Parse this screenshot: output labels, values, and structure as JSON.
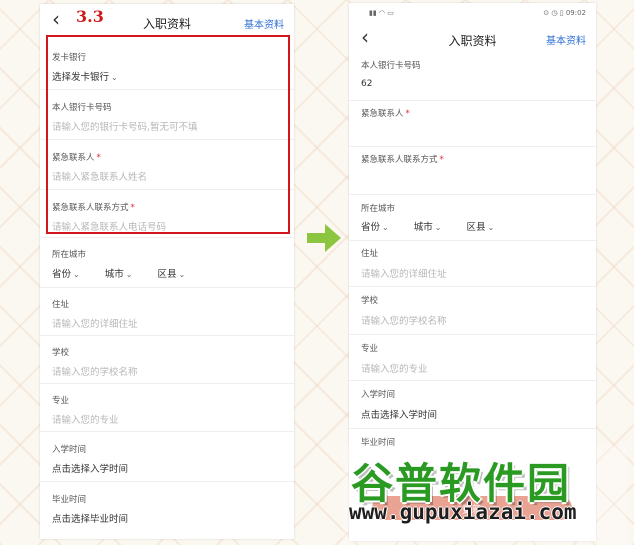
{
  "step_label": "3.3",
  "left_screen": {
    "back_icon": "chevron-left-icon",
    "title": "入职资料",
    "right_link": "基本资料",
    "fields": [
      {
        "label": "发卡银行",
        "required": false,
        "value": "选择发卡银行",
        "is_placeholder": false,
        "dropdown": true
      },
      {
        "label": "本人银行卡号码",
        "required": false,
        "value": "请输入您的银行卡号码,暂无可不填",
        "is_placeholder": true
      },
      {
        "label": "紧急联系人",
        "required": true,
        "value": "请输入紧急联系人姓名",
        "is_placeholder": true
      },
      {
        "label": "紧急联系人联系方式",
        "required": true,
        "value": "请输入紧急联系人电话号码",
        "is_placeholder": true
      }
    ],
    "city": {
      "label": "所在城市",
      "province": "省份",
      "city": "城市",
      "district": "区县"
    },
    "address": {
      "label": "住址",
      "placeholder": "请输入您的详细住址"
    },
    "school": {
      "label": "学校",
      "placeholder": "请输入您的学校名称"
    },
    "major": {
      "label": "专业",
      "placeholder": "请输入您的专业"
    },
    "enroll": {
      "label": "入学时间",
      "value": "点击选择入学时间"
    },
    "graduate": {
      "label": "毕业时间",
      "value": "点击选择毕业时间"
    }
  },
  "right_screen": {
    "status_bar": {
      "time": "09:02",
      "left_icons": "signal-wifi-icon",
      "right_icons": "status-icons"
    },
    "back_icon": "chevron-left-icon",
    "title": "入职资料",
    "right_link": "基本资料",
    "fields": [
      {
        "label": "本人银行卡号码",
        "required": false,
        "value": "62",
        "is_placeholder": false
      },
      {
        "label": "紧急联系人",
        "required": true,
        "value": "",
        "is_placeholder": false
      },
      {
        "label": "紧急联系人联系方式",
        "required": true,
        "value": "",
        "is_placeholder": false
      }
    ],
    "city": {
      "label": "所在城市",
      "province": "省份",
      "city": "城市",
      "district": "区县"
    },
    "address": {
      "label": "住址",
      "placeholder": "请输入您的详细住址"
    },
    "school": {
      "label": "学校",
      "placeholder": "请输入您的学校名称"
    },
    "major": {
      "label": "专业",
      "placeholder": "请输入您的专业"
    },
    "enroll": {
      "label": "入学时间",
      "value": "点击选择入学时间"
    },
    "graduate": {
      "label": "毕业时间"
    },
    "submit_button": "更新"
  },
  "watermark": {
    "title": "谷普软件园",
    "url": "www.gupuxiazai.com"
  },
  "colors": {
    "accent_blue": "#2f6fd6",
    "highlight_red": "#d2161b",
    "arrow_green": "#8cc63e",
    "required_red": "#e0263a",
    "watermark_green": "#2b9a23"
  }
}
